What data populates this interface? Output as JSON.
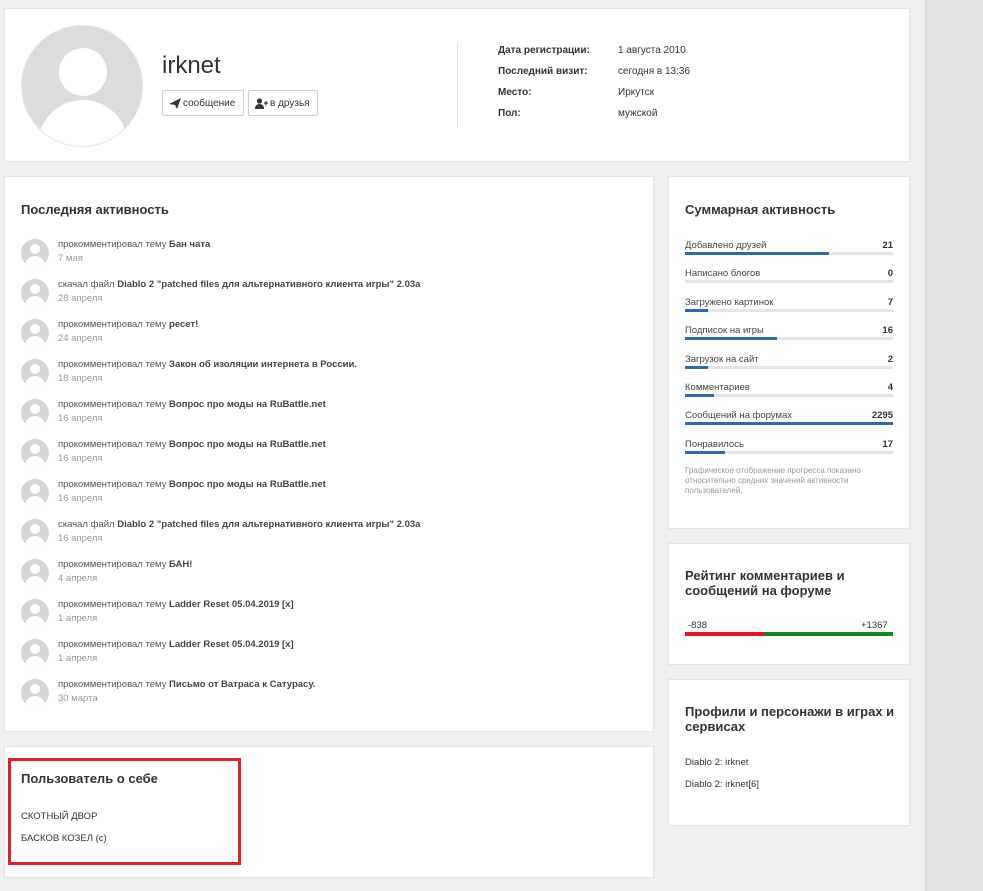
{
  "profile": {
    "username": "irknet",
    "message_btn": "сообщение",
    "friend_btn": "в друзья",
    "info": [
      {
        "label": "Дата регистрации:",
        "value": "1 августа 2010"
      },
      {
        "label": "Последний визит:",
        "value": "сегодня в 13:36"
      },
      {
        "label": "Место:",
        "value": "Иркутск"
      },
      {
        "label": "Пол:",
        "value": "мужской"
      }
    ]
  },
  "activity": {
    "title": "Последняя активность",
    "items": [
      {
        "action": "прокомментировал тему",
        "target": "Бан чата",
        "date": "7 мая"
      },
      {
        "action": "скачал файл",
        "target": "Diablo 2 \"patched files для альтернативного клиента игры\" 2.03a",
        "date": "28 апреля"
      },
      {
        "action": "прокомментировал тему",
        "target": "ресет!",
        "date": "24 апреля"
      },
      {
        "action": "прокомментировал тему",
        "target": "Закон об изоляции интернета в России.",
        "date": "18 апреля"
      },
      {
        "action": "прокомментировал тему",
        "target": "Вопрос про моды на RuBattle.net",
        "date": "16 апреля"
      },
      {
        "action": "прокомментировал тему",
        "target": "Вопрос про моды на RuBattle.net",
        "date": "16 апреля"
      },
      {
        "action": "прокомментировал тему",
        "target": "Вопрос про моды на RuBattle.net",
        "date": "16 апреля"
      },
      {
        "action": "скачал файл",
        "target": "Diablo 2 \"patched files для альтернативного клиента игры\" 2.03a",
        "date": "16 апреля"
      },
      {
        "action": "прокомментировал тему",
        "target": "БАН!",
        "date": "4 апреля"
      },
      {
        "action": "прокомментировал тему",
        "target": "Ladder Reset 05.04.2019 [x]",
        "date": "1 апреля"
      },
      {
        "action": "прокомментировал тему",
        "target": "Ladder Reset 05.04.2019 [x]",
        "date": "1 апреля"
      },
      {
        "action": "прокомментировал тему",
        "target": "Письмо от Ватраса к Сатурасу.",
        "date": "30 марта"
      }
    ]
  },
  "about": {
    "title": "Пользователь о себе",
    "lines": [
      "СКОТНЫЙ ДВОР",
      "БАСКОВ КОЗЕЛ (с)"
    ]
  },
  "stats": {
    "title": "Суммарная активность",
    "items": [
      {
        "label": "Добавлено друзей",
        "value": "21",
        "fill": 0.69
      },
      {
        "label": "Написано блогов",
        "value": "0",
        "fill": 0.0
      },
      {
        "label": "Загружено картинок",
        "value": "7",
        "fill": 0.11
      },
      {
        "label": "Подписок на игры",
        "value": "16",
        "fill": 0.44
      },
      {
        "label": "Загрузок на сайт",
        "value": "2",
        "fill": 0.11
      },
      {
        "label": "Комментариев",
        "value": "4",
        "fill": 0.14
      },
      {
        "label": "Сообщений на форумах",
        "value": "2295",
        "fill": 1.0
      },
      {
        "label": "Понравилось",
        "value": "17",
        "fill": 0.19
      }
    ],
    "note": "Графическое отображение прогресса показано относительно средних значений активности пользователей."
  },
  "rating": {
    "title": "Рейтинг комментариев и сообщений на форуме",
    "negative": "-838",
    "positive": "+1367",
    "negative_share": 0.38
  },
  "games": {
    "title": "Профили и персонажи в играх и сервисах",
    "items": [
      "Diablo 2: irknet",
      "Diablo 2: irknet[6]"
    ]
  },
  "colors": {
    "accent_blue": "#2a6ab0",
    "rating_negative": "#e8141b",
    "rating_positive": "#0f8a14",
    "highlight_border": "#e3202a"
  }
}
